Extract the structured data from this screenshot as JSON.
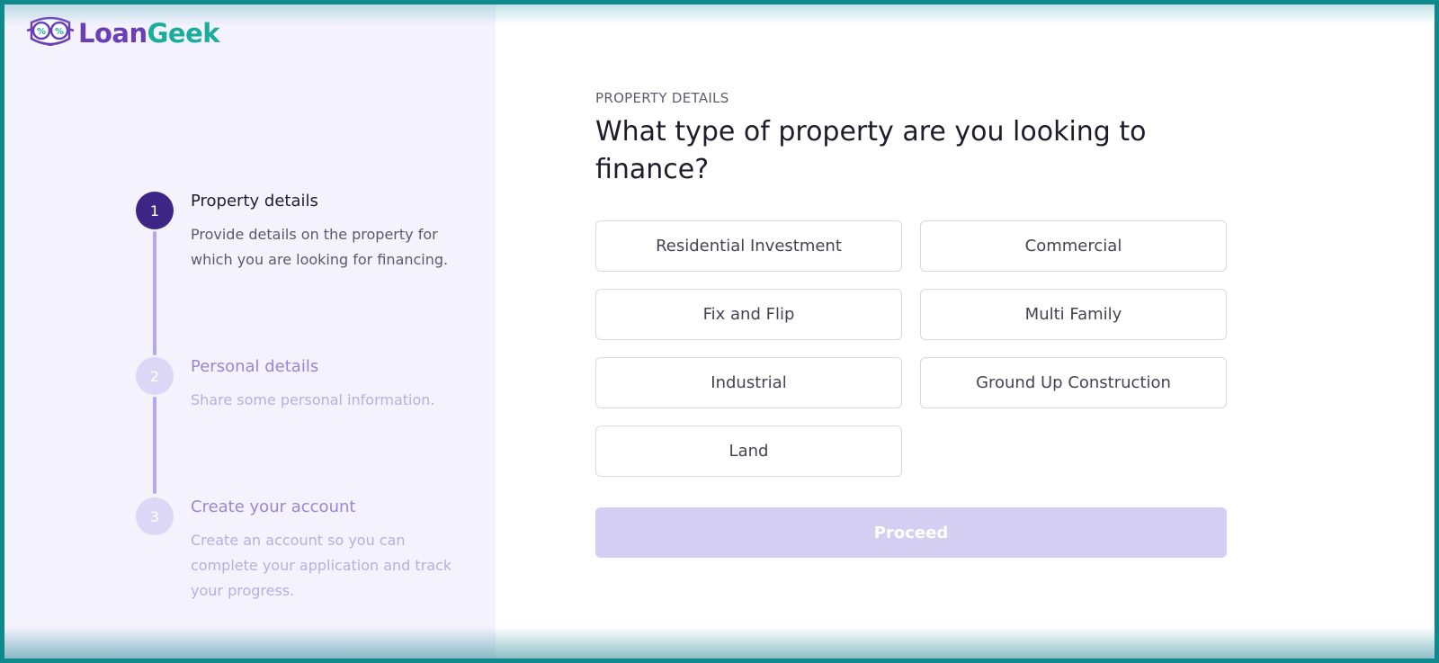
{
  "brand": {
    "name_part1": "Loan",
    "name_part2": "Geek",
    "logo_icon": "glasses-percent-icon",
    "color_purple": "#6a3fb5",
    "color_teal": "#19ad9e"
  },
  "steps": [
    {
      "number": "1",
      "title": "Property details",
      "description": "Provide details on the property for which you are looking for financing.",
      "state": "active"
    },
    {
      "number": "2",
      "title": "Personal details",
      "description": "Share some personal information.",
      "state": "inactive"
    },
    {
      "number": "3",
      "title": "Create your account",
      "description": "Create an account so you can complete your application and track your progress.",
      "state": "inactive"
    }
  ],
  "main": {
    "section_label": "PROPERTY DETAILS",
    "question": "What type of property are you looking to finance?",
    "options": [
      "Residential Investment",
      "Commercial",
      "Fix and Flip",
      "Multi Family",
      "Industrial",
      "Ground Up Construction",
      "Land"
    ],
    "proceed_label": "Proceed"
  },
  "colors": {
    "step_active": "#3c2585",
    "step_inactive": "#dcd6f7",
    "proceed_disabled": "#d4cff2",
    "frame": "#0f8a8c"
  }
}
